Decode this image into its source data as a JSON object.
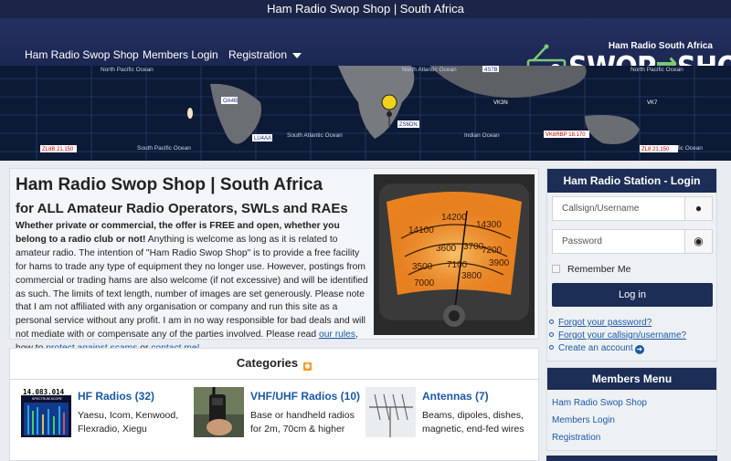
{
  "topbar": {
    "title": "Ham Radio Swop Shop | South Africa"
  },
  "nav": {
    "items": [
      "Ham Radio Swop Shop",
      "Members Login",
      "Registration"
    ]
  },
  "logo": {
    "small": "Ham Radio South Africa",
    "left": "SWOP",
    "right": "SHOP"
  },
  "map": {
    "labels": [
      "North Pacific Ocean",
      "North Atlantic Ocean",
      "South Atlantic Ocean",
      "Indian Ocean",
      "South Pacific Ocean",
      "South Pacific Ocean",
      "North Pacific Ocean"
    ],
    "callouts": [
      "ZS6DN",
      "LU4AA",
      "OA4B",
      "ZL8B 21.150",
      "VK6RBP 18.170",
      "ZL8 21.150",
      "4S7B",
      "VK3N",
      "VK7"
    ]
  },
  "intro": {
    "title": "Ham Radio Swop Shop | South Africa",
    "subtitle": "for ALL Amateur Radio Operators, SWLs and RAEs",
    "bold_lead": "Whether private or commercial, the offer is FREE and open, whether you belong to a radio club or not!",
    "body": " Anything is welcome as long as it is related to amateur radio. The intention of \"Ham Radio Swop Shop\" is to provide a free facility for hams to trade any type of equipment they no longer use. However, postings from commercial or trading hams are also welcome (if not excessive) and will be identified as such. The limits of text length, number of images are set generously. Please note that I am not affiliated with any organisation or company and run this site as a personal service without any profit. I am in no way responsible for bad deals and will not mediate with or compensate any of the parties involved. Please read ",
    "link_rules": "our rules",
    "mid1": ", how to ",
    "link_scams": "protect against scams",
    "mid2": " or ",
    "link_contact": "contact me!"
  },
  "login": {
    "heading": "Ham Radio Station - Login",
    "username_placeholder": "Callsign/Username",
    "password_placeholder": "Password",
    "remember": "Remember Me",
    "button": "Log in",
    "forgot_password": "Forgot your password?",
    "forgot_username": "Forgot your callsign/username?",
    "create_account": "Create an account"
  },
  "members_menu": {
    "heading": "Members Menu",
    "items": [
      "Ham Radio Swop Shop",
      "Members Login",
      "Registration"
    ]
  },
  "categories": {
    "heading": "Categories",
    "items": [
      {
        "title": "HF Radios (32)",
        "desc": "Yaesu, Icom, Kenwood, Flexradio, Xiegu",
        "thumb_text": "14.083.014",
        "thumb_sub": "SPECTRUM SCOPE"
      },
      {
        "title": "VHF/UHF Radios (10)",
        "desc": "Base or handheld radios for 2m, 70cm & higher"
      },
      {
        "title": "Antennas (7)",
        "desc": "Beams, dipoles, dishes, magnetic, end-fed wires"
      }
    ]
  },
  "meter": {
    "scale_a": [
      "14100",
      "14200",
      "14300"
    ],
    "scale_b": [
      "3500",
      "3600",
      "3700",
      "3800",
      "3900"
    ],
    "scale_c": [
      "7000",
      "7100",
      "7200"
    ]
  },
  "colors": {
    "nav": "#1c2752",
    "accent": "#1c2d56",
    "link": "#1c59a5",
    "logo_arrows": "#7fc878",
    "rss": "#f39a1e"
  }
}
